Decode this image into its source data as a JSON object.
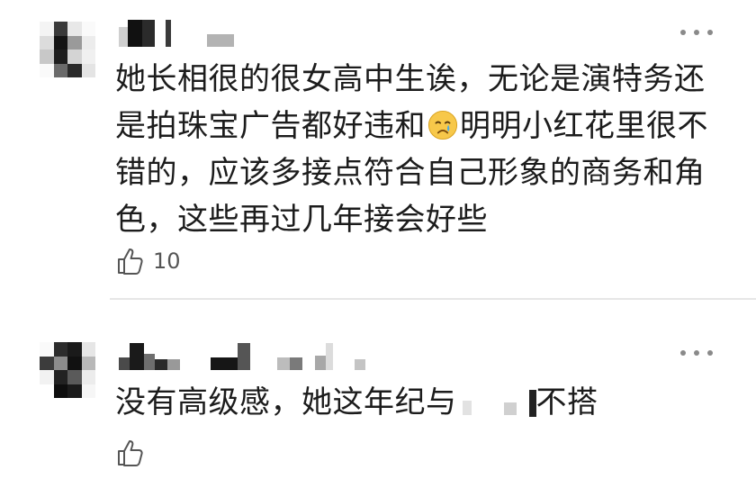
{
  "comments": [
    {
      "text_line1": "她长相很的很女高中生诶，无论是演特务还",
      "text_line2a": "是拍珠宝广告都好违和",
      "text_line2b": "明明小红花里很不",
      "text_line3": "错的，应该多接点符合自己形象的商务和角",
      "text_line4": "色，这些再过几年接会好些",
      "emoji": "crying-face",
      "likes": "10"
    },
    {
      "text_a": "没有高级感，她这年纪与",
      "text_b": "不搭",
      "likes": ""
    }
  ],
  "icons": {
    "like": "thumbs-up-outline-icon",
    "more": "three-dot-more-icon"
  },
  "colors": {
    "text": "#1c1c1c",
    "meta": "#555555",
    "divider": "#e6e6e6"
  }
}
